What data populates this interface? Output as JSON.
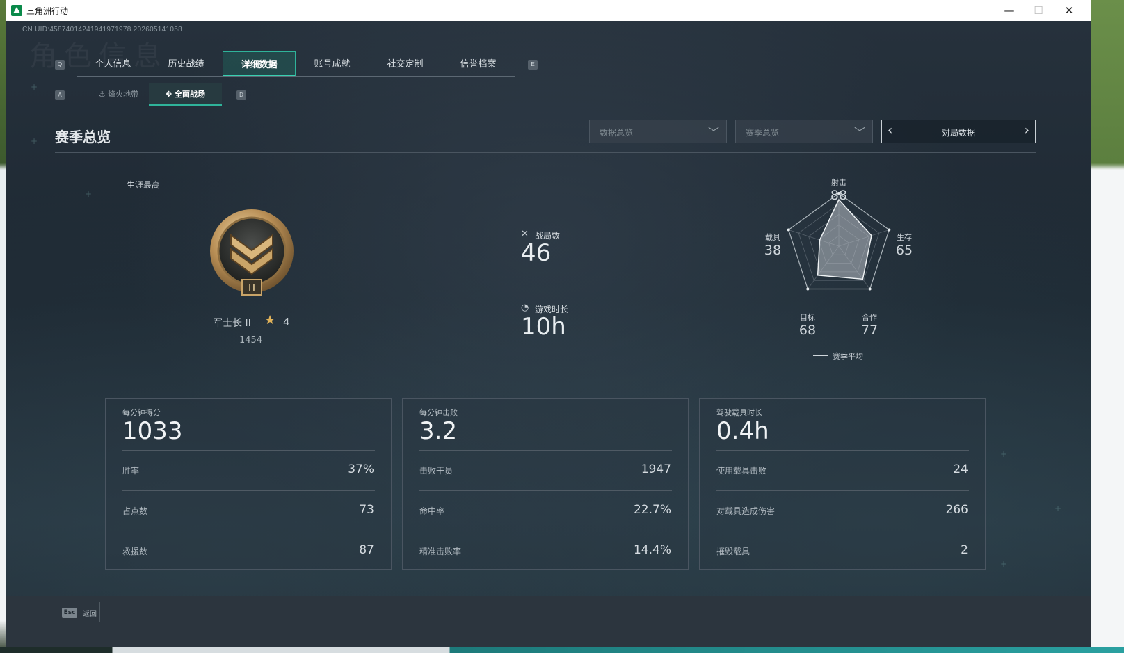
{
  "window": {
    "title": "三角洲行动",
    "minimize": "—",
    "maximize": "☐",
    "close": "✕"
  },
  "uid": "CN UID:458740142419419719​78.202605141058",
  "ghost_title": "角色信息",
  "keycaps": {
    "q": "Q",
    "e": "E",
    "a": "A",
    "d": "D"
  },
  "tabs": [
    {
      "label": "个人信息"
    },
    {
      "label": "历史战绩"
    },
    {
      "label": "详细数据",
      "active": true
    },
    {
      "label": "账号成就"
    },
    {
      "label": "社交定制"
    },
    {
      "label": "信誉档案"
    }
  ],
  "subtabs": [
    {
      "icon": "⚓",
      "label": "烽火地带"
    },
    {
      "icon": "✥",
      "label": "全面战场",
      "active": true
    }
  ],
  "section_title": "赛季总览",
  "dropdowns": [
    {
      "label": "数据总览",
      "arrow": "﹀"
    },
    {
      "label": "赛季总览",
      "arrow": "﹀"
    }
  ],
  "pager": {
    "label": "对局数据",
    "prev": "‹",
    "next": "›"
  },
  "career": {
    "label": "生涯最高",
    "rank_name": "军士长 II",
    "star_icon": "★",
    "stars": "4",
    "score": "1454",
    "badge_numeral": "II"
  },
  "summary": {
    "matches": {
      "icon": "✕",
      "label": "战局数",
      "value": "46"
    },
    "playtime": {
      "icon": "◔",
      "label": "游戏时长",
      "value": "10h"
    }
  },
  "radar": {
    "axes": [
      {
        "label": "射击",
        "value": "88"
      },
      {
        "label": "生存",
        "value": "65"
      },
      {
        "label": "合作",
        "value": "77"
      },
      {
        "label": "目标",
        "value": "68"
      },
      {
        "label": "载具",
        "value": "38"
      }
    ],
    "scores": [
      88,
      65,
      77,
      68,
      38
    ],
    "max": 100,
    "legend": "赛季平均"
  },
  "cards": [
    {
      "title": "每分钟得分",
      "value": "1033",
      "rows": [
        {
          "label": "胜率",
          "value": "37%"
        },
        {
          "label": "占点数",
          "value": "73"
        },
        {
          "label": "救援数",
          "value": "87"
        }
      ]
    },
    {
      "title": "每分钟击败",
      "value": "3.2",
      "rows": [
        {
          "label": "击败干员",
          "value": "1947"
        },
        {
          "label": "命中率",
          "value": "22.7%"
        },
        {
          "label": "精准击败率",
          "value": "14.4%"
        }
      ]
    },
    {
      "title": "驾驶载具时长",
      "value": "0.4h",
      "rows": [
        {
          "label": "使用载具击败",
          "value": "24"
        },
        {
          "label": "对载具造成伤害",
          "value": "266"
        },
        {
          "label": "摧毁载具",
          "value": "2"
        }
      ]
    }
  ],
  "footer": {
    "key": "Esc",
    "label": "返回"
  },
  "colors": {
    "accent": "#2fb39a",
    "panel_border": "#4a5561",
    "radar_fill": "#b9c0c6"
  }
}
